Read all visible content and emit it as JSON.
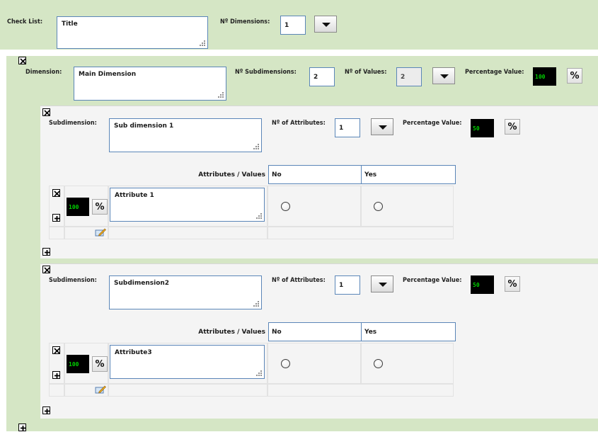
{
  "checklist": {
    "label": "Check List:",
    "title_value": "Title",
    "n_dimensions_label": "Nº Dimensions:",
    "n_dimensions_value": "1"
  },
  "dimension": {
    "label": "Dimension:",
    "name_value": "Main Dimension",
    "n_subdimensions_label": "Nº Subdimensions:",
    "n_subdimensions_value": "2",
    "n_values_label": "Nº of Values:",
    "n_values_value": "2",
    "percentage_label": "Percentage Value:",
    "percentage_value": "100",
    "percent_symbol": "%"
  },
  "subdimensions": [
    {
      "label": "Subdimension:",
      "name_value": "Sub dimension 1",
      "n_attributes_label": "Nº of Attributes:",
      "n_attributes_value": "1",
      "percentage_label": "Percentage Value:",
      "percentage_value": "50",
      "percent_symbol": "%",
      "attributes_values_label": "Attributes / Values",
      "value_columns": [
        "No",
        "Yes"
      ],
      "attribute": {
        "percentage_value": "100",
        "percent_symbol": "%",
        "name_value": "Attribute 1"
      }
    },
    {
      "label": "Subdimension:",
      "name_value": "Subdimension2",
      "n_attributes_label": "Nº of Attributes:",
      "n_attributes_value": "1",
      "percentage_label": "Percentage Value:",
      "percentage_value": "50",
      "percent_symbol": "%",
      "attributes_values_label": "Attributes / Values",
      "value_columns": [
        "No",
        "Yes"
      ],
      "attribute": {
        "percentage_value": "100",
        "percent_symbol": "%",
        "name_value": "Attribute3"
      }
    }
  ],
  "icons": {
    "remove": "close-box-icon",
    "add": "plus-box-icon",
    "edit": "edit-pencil-icon",
    "dropdown": "caret-down-icon"
  },
  "colors": {
    "band_green": "#d5e6c5",
    "panel_gray": "#f4f4f4",
    "field_border": "#5b86b8",
    "percent_bg": "#000000",
    "percent_text": "#00d000"
  }
}
